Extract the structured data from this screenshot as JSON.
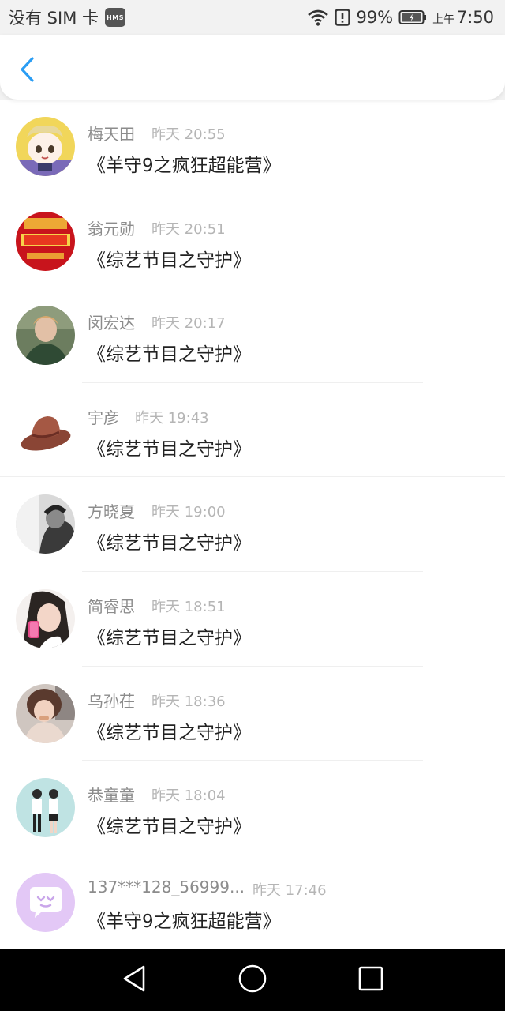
{
  "status_bar": {
    "carrier": "没有 SIM 卡",
    "hms_badge": "HMS",
    "battery_percent": "99%",
    "time_prefix": "上午",
    "time": "7:50",
    "icons": [
      "wifi-icon",
      "alert-icon",
      "battery-icon"
    ]
  },
  "header": {
    "back_icon": "chevron-left-icon",
    "accent_color": "#2a9df4"
  },
  "list": {
    "items": [
      {
        "name": "梅天田",
        "time": "昨天 20:55",
        "title": "《羊守9之疯狂超能营》",
        "avatar": "cartoon-avatar"
      },
      {
        "name": "翁元勋",
        "time": "昨天 20:51",
        "title": "《综艺节目之守护》",
        "avatar": "red-festival-avatar"
      },
      {
        "name": "闵宏达",
        "time": "昨天 20:17",
        "title": "《综艺节目之守护》",
        "avatar": "photo-avatar"
      },
      {
        "name": "宇彦",
        "time": "昨天 19:43",
        "title": "《综艺节目之守护》",
        "avatar": "hat-avatar"
      },
      {
        "name": "方晓夏",
        "time": "昨天 19:00",
        "title": "《综艺节目之守护》",
        "avatar": "bw-photo-avatar"
      },
      {
        "name": "简睿思",
        "time": "昨天 18:51",
        "title": "《综艺节目之守护》",
        "avatar": "photo-avatar"
      },
      {
        "name": "乌孙茌",
        "time": "昨天 18:36",
        "title": "《综艺节目之守护》",
        "avatar": "photo-avatar"
      },
      {
        "name": "恭童童",
        "time": "昨天 18:04",
        "title": "《综艺节目之守护》",
        "avatar": "couple-photo-avatar"
      },
      {
        "name": "137***128_56999...",
        "time": "昨天 17:46",
        "title": "《羊守9之疯狂超能营》",
        "avatar": "default-chat-avatar"
      }
    ]
  },
  "nav_bar": {
    "icons": [
      "back-triangle-icon",
      "home-circle-icon",
      "recents-square-icon"
    ]
  }
}
